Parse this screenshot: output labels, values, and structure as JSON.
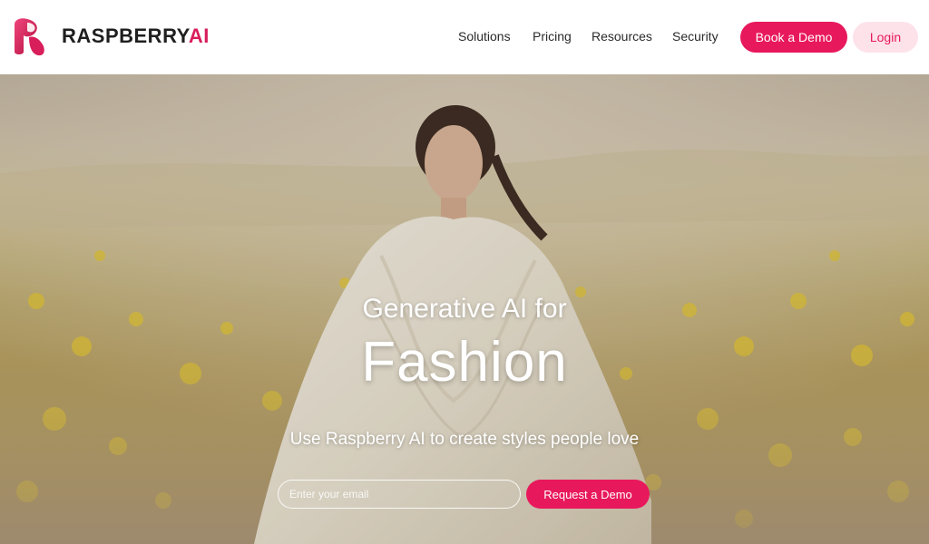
{
  "brand": {
    "name_main": "RASPBERRY",
    "name_accent": "AI",
    "logo_icon": "raspberry-r-logo",
    "accent_color": "#e8185c"
  },
  "nav": {
    "items": [
      {
        "label": "Solutions"
      },
      {
        "label": "Pricing"
      },
      {
        "label": "Resources"
      },
      {
        "label": "Security"
      }
    ],
    "book_demo_label": "Book a Demo",
    "login_label": "Login"
  },
  "hero": {
    "subtitle": "Generative AI for",
    "title": "Fashion",
    "tagline": "Use Raspberry AI to create styles people love",
    "email_placeholder": "Enter your email",
    "email_value": "",
    "cta_label": "Request a Demo"
  }
}
